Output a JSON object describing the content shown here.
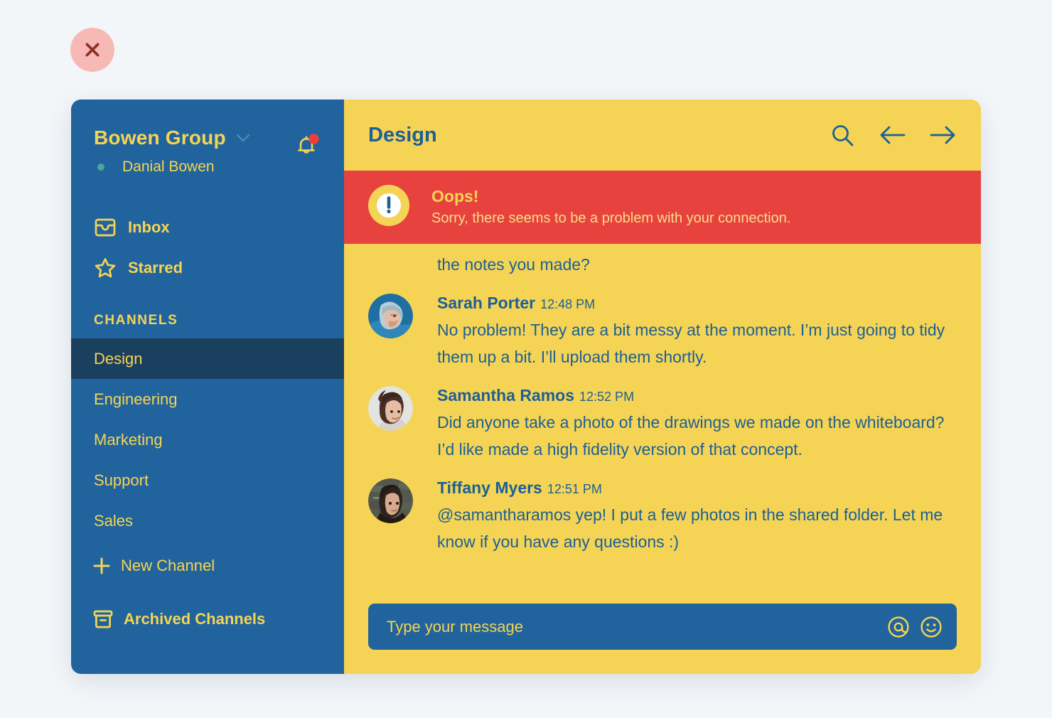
{
  "close_button": {
    "name": "close-window",
    "bg": "#f6b9b5",
    "glyph": "#8e2f28"
  },
  "colors": {
    "sidebar_blue": "#21639c",
    "active_channel": "#1b3f5f",
    "panel_yellow": "#f5d455",
    "error_red": "#e8423f",
    "text_blue": "#1d5f96",
    "presence_green": "#4aa79b",
    "notification_red": "#ef3e36"
  },
  "sidebar": {
    "org_name": "Bowen Group",
    "org_caret": "chevron-down-icon",
    "notification_bell": "bell-icon",
    "user_name": "Danial Bowen",
    "nav": [
      {
        "label": "Inbox",
        "icon": "inbox-icon"
      },
      {
        "label": "Starred",
        "icon": "star-icon"
      }
    ],
    "section_label": "CHANNELS",
    "channels": [
      {
        "label": "Design",
        "active": true
      },
      {
        "label": "Engineering",
        "active": false
      },
      {
        "label": "Marketing",
        "active": false
      },
      {
        "label": "Support",
        "active": false
      },
      {
        "label": "Sales",
        "active": false
      }
    ],
    "new_channel": {
      "label": "New Channel",
      "icon": "plus-icon"
    },
    "archived": {
      "label": "Archived Channels",
      "icon": "archive-box-icon"
    }
  },
  "header": {
    "title": "Design",
    "actions": [
      {
        "name": "search-icon"
      },
      {
        "name": "arrow-left-icon"
      },
      {
        "name": "arrow-right-icon"
      }
    ]
  },
  "banner": {
    "icon": "exclamation-circle-icon",
    "title": "Oops!",
    "message": "Sorry, there seems to be a problem with your connection."
  },
  "conversation": {
    "truncated_previous_line": "the notes you made?",
    "messages": [
      {
        "author": "Sarah Porter",
        "time": "12:48 PM",
        "avatar": "avatar-sarah-porter",
        "text": "No problem! They are a bit messy at the moment. I’m just going to tidy them up a bit. I’ll upload them shortly."
      },
      {
        "author": "Samantha Ramos",
        "time": "12:52 PM",
        "avatar": "avatar-samantha-ramos",
        "text": "Did anyone take a photo of the drawings we made on the whiteboard? I’d like made a high fidelity version of that concept."
      },
      {
        "author": "Tiffany Myers",
        "time": "12:51 PM",
        "avatar": "avatar-tiffany-myers",
        "text": "@samantharamos yep! I put a few photos in the shared folder. Let me know if you have any questions :)"
      }
    ]
  },
  "composer": {
    "placeholder": "Type your message",
    "value": "",
    "icons": [
      {
        "name": "mention-icon"
      },
      {
        "name": "emoji-icon"
      }
    ]
  }
}
